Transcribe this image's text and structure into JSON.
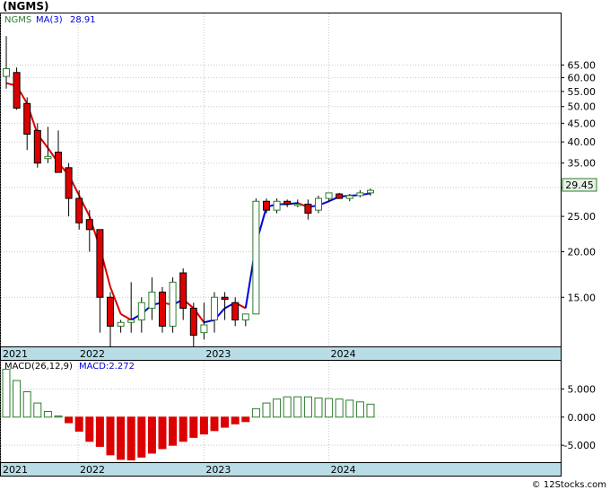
{
  "title": "(NGMS)",
  "copyright": "© 12Stocks.com",
  "colors": {
    "up": "#2e7d2e",
    "down": "#dd0000",
    "ma_up": "#0000dd",
    "ma_down": "#dd0000",
    "axis_band": "#b8dde6",
    "macd_up": "#2e7d2e",
    "macd_down": "#dd0000"
  },
  "chart_data": [
    {
      "type": "candlestick",
      "legend": {
        "symbol": "NGMS",
        "ma_label": "MA(3)",
        "ma_value": "28.91"
      },
      "last_price_label": "29.45",
      "y_scale": "log",
      "ylim": [
        11,
        90
      ],
      "y_ticks": [
        "15.00",
        "20.00",
        "25.00",
        "30.00",
        "35.00",
        "40.00",
        "45.00",
        "50.00",
        "55.00",
        "60.00",
        "65.00"
      ],
      "x_labels": [
        "2021",
        "2022",
        "2023",
        "2024"
      ],
      "candles": [
        {
          "o": 60.5,
          "h": 78,
          "l": 56,
          "c": 63.5
        },
        {
          "o": 62,
          "h": 64,
          "l": 49,
          "c": 49.5
        },
        {
          "o": 51,
          "h": 53,
          "l": 38,
          "c": 42
        },
        {
          "o": 43,
          "h": 45,
          "l": 34,
          "c": 35
        },
        {
          "o": 36,
          "h": 44,
          "l": 35,
          "c": 36.5
        },
        {
          "o": 37.5,
          "h": 43,
          "l": 33,
          "c": 33
        },
        {
          "o": 34,
          "h": 35,
          "l": 25,
          "c": 28
        },
        {
          "o": 28,
          "h": 29.5,
          "l": 23,
          "c": 24
        },
        {
          "o": 24.5,
          "h": 26,
          "l": 20,
          "c": 23
        },
        {
          "o": 23,
          "h": 23,
          "l": 12,
          "c": 15
        },
        {
          "o": 15,
          "h": 15.5,
          "l": 10,
          "c": 12.5
        },
        {
          "o": 12.5,
          "h": 13,
          "l": 12,
          "c": 12.8
        },
        {
          "o": 12.8,
          "h": 16.5,
          "l": 12,
          "c": 13
        },
        {
          "o": 13,
          "h": 15,
          "l": 12,
          "c": 14.5
        },
        {
          "o": 14,
          "h": 17,
          "l": 13,
          "c": 15.5
        },
        {
          "o": 15.5,
          "h": 16,
          "l": 12,
          "c": 12.5
        },
        {
          "o": 12.5,
          "h": 17,
          "l": 12,
          "c": 16.5
        },
        {
          "o": 17.5,
          "h": 18,
          "l": 13,
          "c": 14
        },
        {
          "o": 14,
          "h": 14.5,
          "l": 11,
          "c": 11.8
        },
        {
          "o": 12,
          "h": 14.5,
          "l": 11.5,
          "c": 12.6
        },
        {
          "o": 13,
          "h": 15.5,
          "l": 12,
          "c": 15
        },
        {
          "o": 15,
          "h": 15.5,
          "l": 13,
          "c": 14.8
        },
        {
          "o": 14.5,
          "h": 15,
          "l": 12.5,
          "c": 13
        },
        {
          "o": 13,
          "h": 13.5,
          "l": 12.5,
          "c": 13.5
        },
        {
          "o": 13.5,
          "h": 28,
          "l": 13.5,
          "c": 27.5
        },
        {
          "o": 27.5,
          "h": 28,
          "l": 25.5,
          "c": 26
        },
        {
          "o": 26,
          "h": 28,
          "l": 25.5,
          "c": 27.5
        },
        {
          "o": 27.5,
          "h": 27.8,
          "l": 26.5,
          "c": 27
        },
        {
          "o": 27,
          "h": 27.8,
          "l": 26.5,
          "c": 27
        },
        {
          "o": 27,
          "h": 27.8,
          "l": 24.5,
          "c": 25.5
        },
        {
          "o": 26,
          "h": 28.5,
          "l": 25.5,
          "c": 28
        },
        {
          "o": 28,
          "h": 29,
          "l": 27.5,
          "c": 29
        },
        {
          "o": 28.8,
          "h": 29,
          "l": 28,
          "c": 28
        },
        {
          "o": 28,
          "h": 28.8,
          "l": 27.5,
          "c": 28.5
        },
        {
          "o": 28.5,
          "h": 29.5,
          "l": 28.2,
          "c": 29
        },
        {
          "o": 29,
          "h": 29.8,
          "l": 28.5,
          "c": 29.45
        }
      ],
      "ma_values": [
        58,
        57,
        51,
        42,
        38.5,
        35,
        32.5,
        28.5,
        25,
        20.5,
        16,
        13.5,
        13,
        13.5,
        14.3,
        14.5,
        14.3,
        14.8,
        14,
        12.8,
        13,
        14,
        14.5,
        14,
        21,
        26.5,
        27,
        27,
        27.2,
        26.5,
        26.8,
        27.5,
        28.3,
        28.5,
        28.6,
        28.91
      ]
    },
    {
      "type": "bar",
      "legend": {
        "label": "MACD(26,12,9)",
        "value_label": "MACD:2.272"
      },
      "ylim": [
        -8,
        10
      ],
      "y_ticks": [
        "5.000",
        "0.000",
        "-5.000"
      ],
      "x_labels": [
        "2021",
        "2022",
        "2023",
        "2024"
      ],
      "values": [
        8.5,
        6.5,
        4.5,
        2.5,
        1.0,
        0.2,
        -1.0,
        -2.5,
        -4.3,
        -5.2,
        -6.7,
        -7.5,
        -7.6,
        -7.1,
        -6.4,
        -5.6,
        -5.0,
        -4.3,
        -3.6,
        -3.0,
        -2.4,
        -1.8,
        -1.2,
        -0.8,
        1.5,
        2.5,
        3.2,
        3.6,
        3.6,
        3.6,
        3.4,
        3.3,
        3.2,
        3.0,
        2.7,
        2.3
      ]
    }
  ]
}
